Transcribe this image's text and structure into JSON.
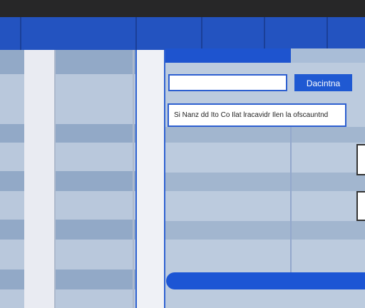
{
  "toolbar": {
    "search_value": "",
    "search_button_label": "Dacintna"
  },
  "notice": {
    "text": "Si  Nanz  dd  Ito  Co  Ilat  lracavidr  Ilen  la  ofscauntnd"
  },
  "colors": {
    "topbar": "#272728",
    "header": "#2353c0",
    "accent": "#1f59d2",
    "panel": "#bccbde"
  }
}
